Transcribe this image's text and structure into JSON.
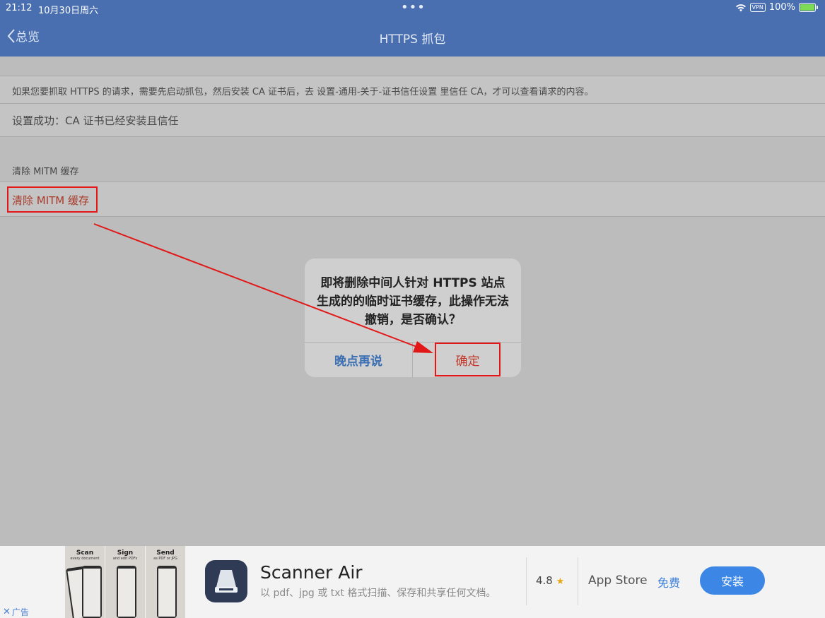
{
  "status_bar": {
    "time": "21:12",
    "date": "10月30日周六",
    "dots": "•••",
    "vpn": "VPN",
    "battery": "100%",
    "battery_level": 1.0
  },
  "nav": {
    "back_label": "总览",
    "title": "HTTPS 抓包"
  },
  "content": {
    "info_text": "如果您要抓取 HTTPS 的请求，需要先启动抓包，然后安装 CA 证书后，去 设置-通用-关于-证书信任设置 里信任 CA，才可以查看请求的内容。",
    "status_text": "设置成功：CA 证书已经安装且信任",
    "section_header": "清除 MITM 缓存",
    "clear_button": "清除 MITM 缓存"
  },
  "dialog": {
    "message": "即将删除中间人针对 HTTPS 站点生成的的临时证书缓存，此操作无法撤销，是否确认？",
    "cancel_label": "晚点再说",
    "confirm_label": "确定"
  },
  "ad": {
    "label": "广告",
    "screens": [
      {
        "title": "Scan",
        "subtitle": "every document"
      },
      {
        "title": "Sign",
        "subtitle": "and edit PDFs"
      },
      {
        "title": "Send",
        "subtitle": "as PDF or JPG"
      }
    ],
    "app_name": "Scanner Air",
    "description": "以 pdf、jpg 或 txt 格式扫描、保存和共享任何文档。",
    "rating": "4.8",
    "store": "App Store",
    "price": "免费",
    "install_label": "安装"
  },
  "colors": {
    "nav_bg": "#4a6fb0",
    "highlight": "#e21818",
    "destructive": "#c0392b",
    "link_blue": "#3a6fb4",
    "install_blue": "#3c86e6"
  }
}
